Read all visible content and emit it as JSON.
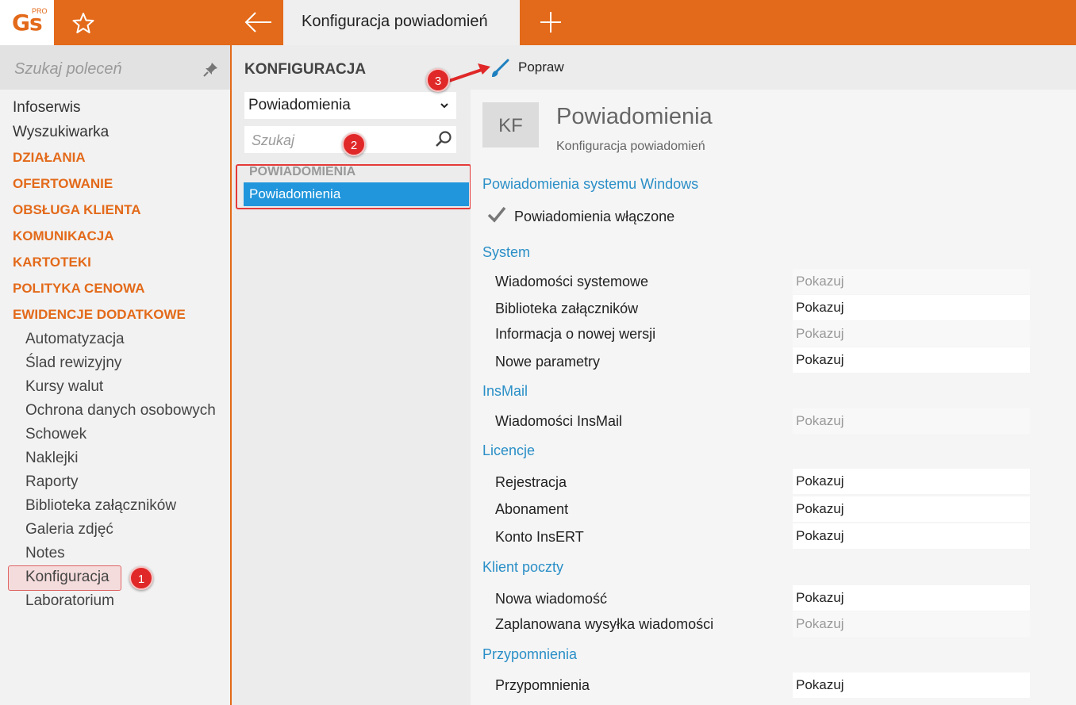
{
  "header": {
    "logo_text": "Gs",
    "logo_sup": "PRO",
    "active_tab": "Konfiguracja powiadomień"
  },
  "left": {
    "search_placeholder": "Szukaj poleceń",
    "top_items": [
      "Infoserwis",
      "Wyszukiwarka"
    ],
    "categories": [
      "DZIAŁANIA",
      "OFERTOWANIE",
      "OBSŁUGA KLIENTA",
      "KOMUNIKACJA",
      "KARTOTEKI",
      "POLITYKA CENOWA",
      "EWIDENCJE DODATKOWE"
    ],
    "sub_items": [
      "Automatyzacja",
      "Ślad rewizyjny",
      "Kursy walut",
      "Ochrona danych osobowych",
      "Schowek",
      "Naklejki",
      "Raporty",
      "Biblioteka załączników",
      "Galeria zdjęć",
      "Notes",
      "Konfiguracja",
      "Laboratorium"
    ]
  },
  "badges": {
    "b1": "1",
    "b2": "2",
    "b3": "3"
  },
  "middle": {
    "title": "KONFIGURACJA",
    "select_value": "Powiadomienia",
    "search_placeholder": "Szukaj",
    "group_header": "POWIADOMIENIA",
    "selected_item": "Powiadomienia"
  },
  "toolbar": {
    "edit_label": "Popraw"
  },
  "content": {
    "avatar": "KF",
    "title": "Powiadomienia",
    "subtitle": "Konfiguracja powiadomień",
    "windows_section": "Powiadomienia systemu Windows",
    "windows_checkbox": "Powiadomienia włączone",
    "sections": [
      {
        "title": "System",
        "rows": [
          {
            "label": "Wiadomości systemowe",
            "value": "Pokazuj",
            "disabled": true
          },
          {
            "label": "Biblioteka załączników",
            "value": "Pokazuj",
            "disabled": false
          },
          {
            "label": "Informacja o nowej wersji",
            "value": "Pokazuj",
            "disabled": true
          },
          {
            "label": "Nowe parametry",
            "value": "Pokazuj",
            "disabled": false
          }
        ]
      },
      {
        "title": "InsMail",
        "rows": [
          {
            "label": "Wiadomości InsMail",
            "value": "Pokazuj",
            "disabled": true
          }
        ]
      },
      {
        "title": "Licencje",
        "rows": [
          {
            "label": "Rejestracja",
            "value": "Pokazuj",
            "disabled": false
          },
          {
            "label": "Abonament",
            "value": "Pokazuj",
            "disabled": false
          },
          {
            "label": "Konto InsERT",
            "value": "Pokazuj",
            "disabled": false
          }
        ]
      },
      {
        "title": "Klient poczty",
        "rows": [
          {
            "label": "Nowa wiadomość",
            "value": "Pokazuj",
            "disabled": false
          },
          {
            "label": "Zaplanowana wysyłka wiadomości",
            "value": "Pokazuj",
            "disabled": true
          }
        ]
      },
      {
        "title": "Przypomnienia",
        "rows": [
          {
            "label": "Przypomnienia",
            "value": "Pokazuj",
            "disabled": false
          }
        ]
      }
    ]
  }
}
